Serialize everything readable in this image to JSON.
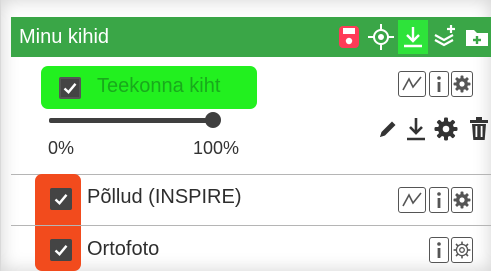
{
  "panel": {
    "title": "Minu kihid",
    "header_icons": [
      "clear-layers-icon",
      "locate-icon",
      "download-icon",
      "layers-add-icon",
      "folder-add-icon"
    ],
    "active_header_icon": "download-icon"
  },
  "layers": [
    {
      "name": "Teekonna kiht",
      "checked": true,
      "highlight": "#22f01f",
      "opacity_min_label": "0%",
      "opacity_max_label": "100%",
      "opacity_value": 1.0,
      "buttons": [
        "chart-icon",
        "info-icon",
        "settings-icon"
      ],
      "tools": [
        "edit-icon",
        "download-icon",
        "settings-icon",
        "delete-icon"
      ]
    },
    {
      "name": "Põllud (INSPIRE)",
      "checked": true,
      "buttons": [
        "chart-icon",
        "info-icon",
        "settings-icon"
      ]
    },
    {
      "name": "Ortofoto",
      "checked": true,
      "buttons": [
        "info-icon",
        "settings-icon"
      ]
    }
  ],
  "colors": {
    "header": "#3aa647",
    "header_active": "#2ee33a",
    "highlight_green": "#22f01f",
    "highlight_red": "#f24b1d",
    "layer_name_active": "#19a91c"
  }
}
